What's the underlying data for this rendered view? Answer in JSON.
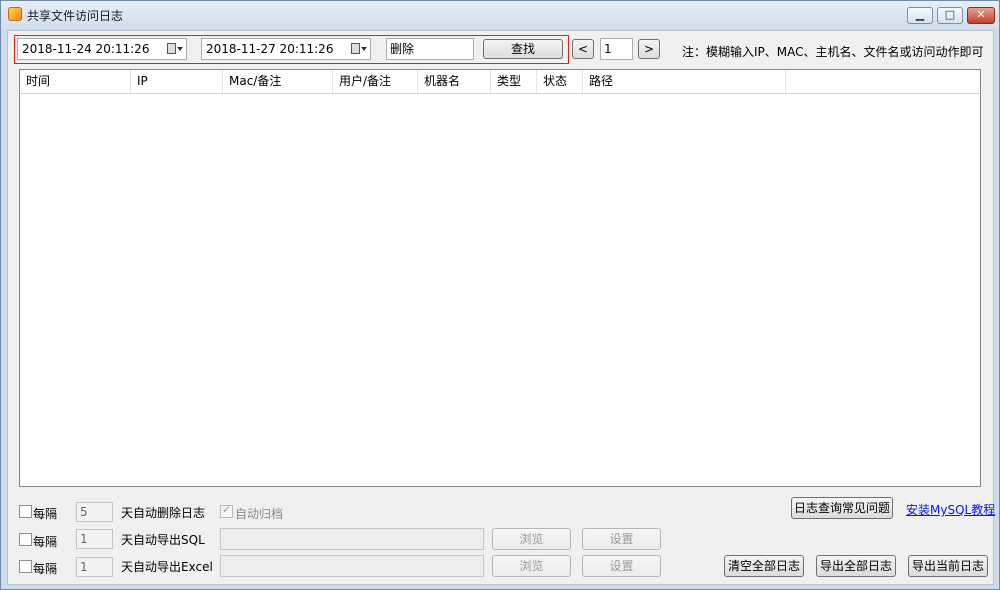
{
  "window": {
    "title": "共享文件访问日志"
  },
  "search": {
    "start_time": "2018-11-24 20:11:26",
    "end_time": "2018-11-27 20:11:26",
    "keyword": "删除",
    "find_label": "查找",
    "prev_label": "<",
    "page": "1",
    "next_label": ">",
    "note": "注：模糊输入IP、MAC、主机名、文件名或访问动作即可"
  },
  "table": {
    "columns": [
      "时间",
      "IP",
      "Mac/备注",
      "用户/备注",
      "机器名",
      "类型",
      "状态",
      "路径"
    ],
    "rows": []
  },
  "options": {
    "every_label": "每隔",
    "delete_days": "5",
    "delete_label": "天自动删除日志",
    "archive_label": "自动归档",
    "sql_days": "1",
    "sql_label": "天自动导出SQL",
    "excel_days": "1",
    "excel_label": "天自动导出Excel",
    "browse_label": "浏览",
    "settings_label": "设置"
  },
  "actions": {
    "faq_label": "日志查询常见问题",
    "mysql_link": "安装MySQL教程",
    "clear_all": "清空全部日志",
    "export_all": "导出全部日志",
    "export_current": "导出当前日志"
  }
}
